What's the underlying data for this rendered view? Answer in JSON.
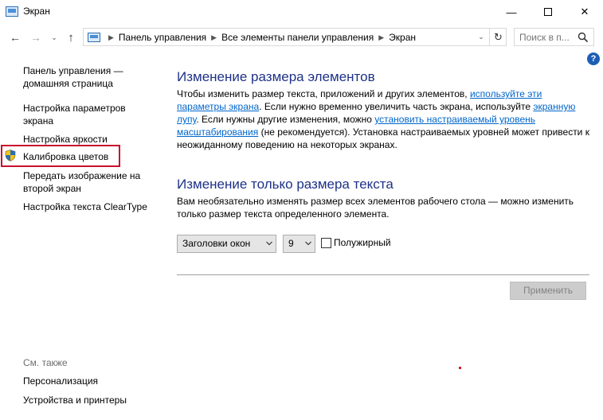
{
  "window": {
    "title": "Экран",
    "minimize": "—",
    "close": "✕"
  },
  "nav": {
    "back": "←",
    "forward": "→",
    "recent": "⌄",
    "up": "↑",
    "breadcrumbs": [
      "Панель управления",
      "Все элементы панели управления",
      "Экран"
    ],
    "dropdown": "⌄",
    "refresh": "↻",
    "search_placeholder": "Поиск в п..."
  },
  "sidebar": {
    "items": [
      "Панель управления —\nдомашняя страница",
      "Настройка параметров\nэкрана",
      "Настройка яркости",
      "Калибровка цветов",
      "Передать изображение на\nвторой экран",
      "Настройка текста ClearType"
    ],
    "see_also": "См. также",
    "also_items": [
      "Персонализация",
      "Устройства и принтеры"
    ]
  },
  "help": "?",
  "section1": {
    "title": "Изменение размера элементов",
    "t1": "Чтобы изменить размер текста, приложений и других элементов, ",
    "link1": "используйте эти параметры экрана",
    "t2": ". Если нужно временно увеличить часть экрана, используйте ",
    "link2": "экранную лупу",
    "t3": ". Если нужны другие изменения, можно ",
    "link3": "установить настраиваемый уровень масштабирования",
    "t4": " (не рекомендуется). Установка настраиваемых уровней может привести к неожиданному поведению на некоторых экранах."
  },
  "section2": {
    "title": "Изменение только размера текста",
    "text": "Вам необязательно изменять размер всех элементов рабочего стола — можно изменить только размер текста определенного элемента.",
    "element_select": "Заголовки окон",
    "size_select": "9",
    "bold_label": "Полужирный",
    "bold_checked": false
  },
  "apply_label": "Применить",
  "colors": {
    "heading": "#1e3287",
    "link": "#0066cc",
    "highlight": "#c8102e"
  }
}
